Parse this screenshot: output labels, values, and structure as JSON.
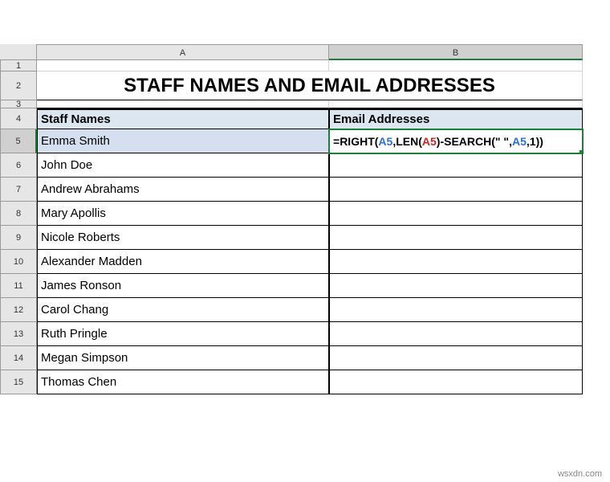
{
  "columns": {
    "A": 364,
    "B": 316
  },
  "title": "STAFF NAMES AND EMAIL ADDRESSES",
  "headers": {
    "A": "Staff Names",
    "B": "Email Addresses"
  },
  "staff": [
    "Emma Smith",
    "John Doe",
    "Andrew Abrahams",
    "Mary Apollis",
    "Nicole Roberts",
    "Alexander Madden",
    "James Ronson",
    "Carol Chang",
    "Ruth Pringle",
    "Megan Simpson",
    "Thomas Chen"
  ],
  "formula": {
    "raw": "=RIGHT(A5,LEN(A5)-SEARCH(\" \",A5,1))",
    "parts": [
      {
        "t": "=",
        "c": "fn"
      },
      {
        "t": "RIGHT(",
        "c": "fn"
      },
      {
        "t": "A5",
        "c": "ref"
      },
      {
        "t": ",",
        "c": "fn"
      },
      {
        "t": "LEN(",
        "c": "fn"
      },
      {
        "t": "A5",
        "c": "ref2"
      },
      {
        "t": ")",
        "c": "fn"
      },
      {
        "t": "-SEARCH(",
        "c": "fn"
      },
      {
        "t": "\" \"",
        "c": "fn"
      },
      {
        "t": ",",
        "c": "fn"
      },
      {
        "t": "A5",
        "c": "ref"
      },
      {
        "t": ",",
        "c": "fn"
      },
      {
        "t": "1",
        "c": "num"
      },
      {
        "t": "))",
        "c": "fn"
      }
    ]
  },
  "active_cell": "B5",
  "row_heights": {
    "default": 30,
    "r1": 14,
    "r2": 36,
    "r3": 10
  },
  "watermark": "wsxdn.com",
  "chart_data": {
    "type": "table",
    "title": "STAFF NAMES AND EMAIL ADDRESSES",
    "columns": [
      "Staff Names",
      "Email Addresses"
    ],
    "rows": [
      [
        "Emma Smith",
        "=RIGHT(A5,LEN(A5)-SEARCH(\" \",A5,1))"
      ],
      [
        "John Doe",
        ""
      ],
      [
        "Andrew Abrahams",
        ""
      ],
      [
        "Mary Apollis",
        ""
      ],
      [
        "Nicole Roberts",
        ""
      ],
      [
        "Alexander Madden",
        ""
      ],
      [
        "James Ronson",
        ""
      ],
      [
        "Carol Chang",
        ""
      ],
      [
        "Ruth Pringle",
        ""
      ],
      [
        "Megan Simpson",
        ""
      ],
      [
        "Thomas Chen",
        ""
      ]
    ]
  }
}
